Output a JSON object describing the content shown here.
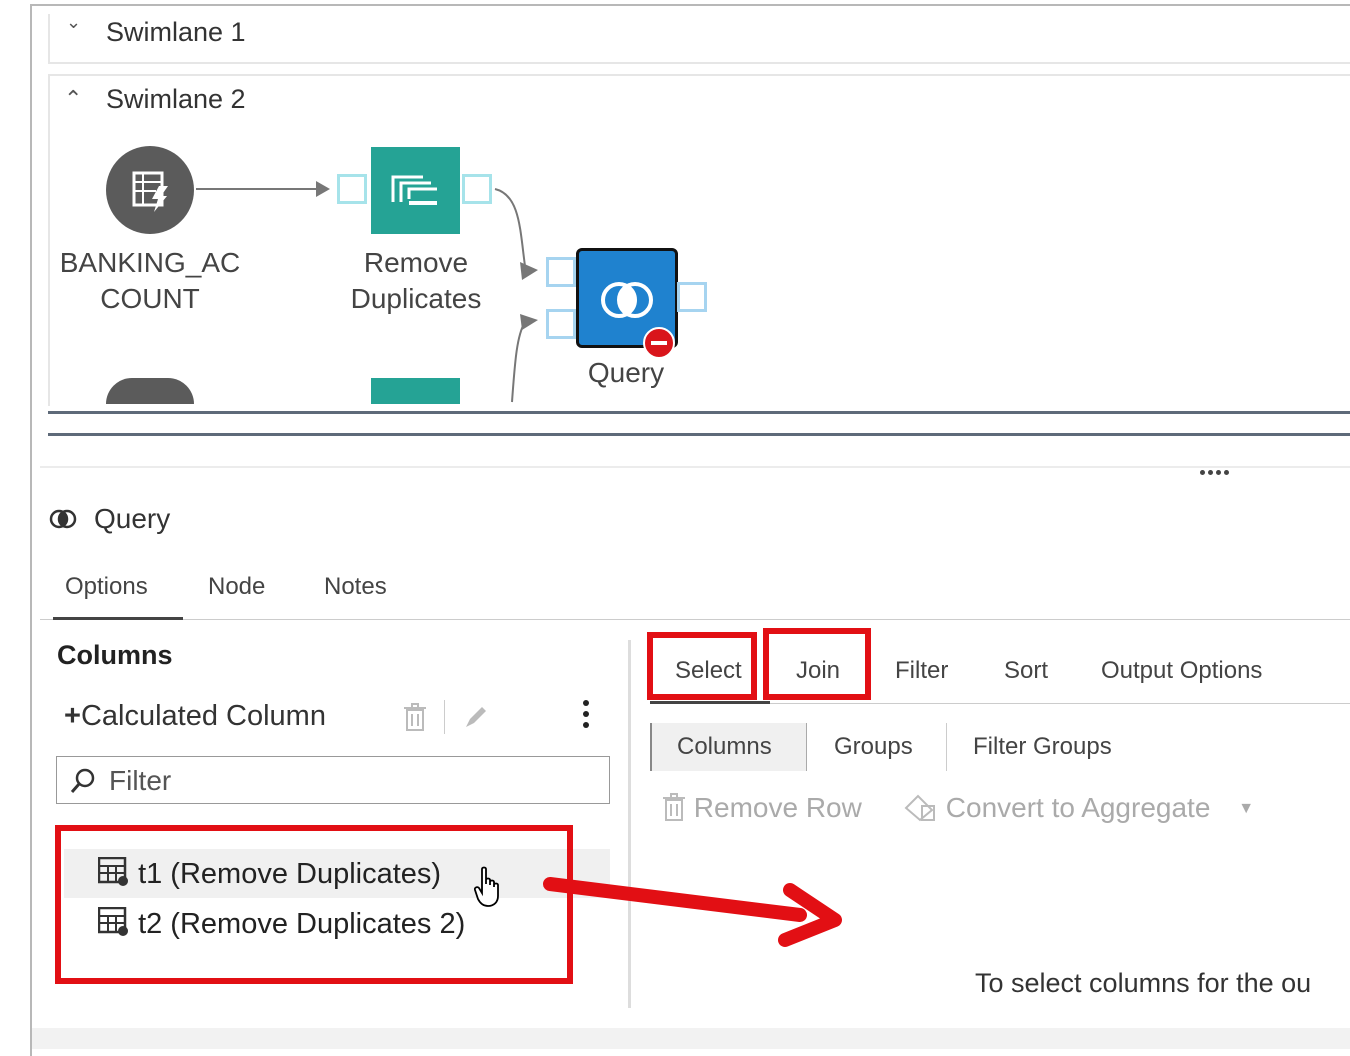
{
  "canvas": {
    "swimlane1": {
      "title": "Swimlane 1"
    },
    "swimlane2": {
      "title": "Swimlane 2"
    },
    "nodes": {
      "source": {
        "label_line1": "BANKING_AC",
        "label_line2": "COUNT",
        "icon": "table-lightning-icon"
      },
      "remove_duplicates": {
        "label_line1": "Remove",
        "label_line2": "Duplicates",
        "icon": "remove-duplicates-icon"
      },
      "query": {
        "label": "Query",
        "icon": "query-join-icon",
        "status": "error"
      }
    }
  },
  "panel": {
    "title": "Query",
    "tabs": [
      "Options",
      "Node",
      "Notes"
    ],
    "active_tab": "Options",
    "columns_section": {
      "heading": "Columns",
      "add_label": "Calculated Column",
      "filter_placeholder": "Filter",
      "items": [
        {
          "label": "t1 (Remove Duplicates)"
        },
        {
          "label": "t2 (Remove Duplicates 2)"
        }
      ]
    },
    "right": {
      "tabs": [
        "Select",
        "Join",
        "Filter",
        "Sort",
        "Output Options"
      ],
      "active_tab": "Select",
      "subtabs": [
        "Columns",
        "Groups",
        "Filter Groups"
      ],
      "active_subtab": "Columns",
      "toolbar": {
        "remove_row": "Remove Row",
        "convert_aggregate": "Convert to Aggregate"
      },
      "empty_message": "To select columns for the ou"
    }
  },
  "colors": {
    "highlight": "#e20f14",
    "node_teal": "#25a395",
    "node_blue": "#1f82cf",
    "source_grey": "#5b5b5b"
  }
}
